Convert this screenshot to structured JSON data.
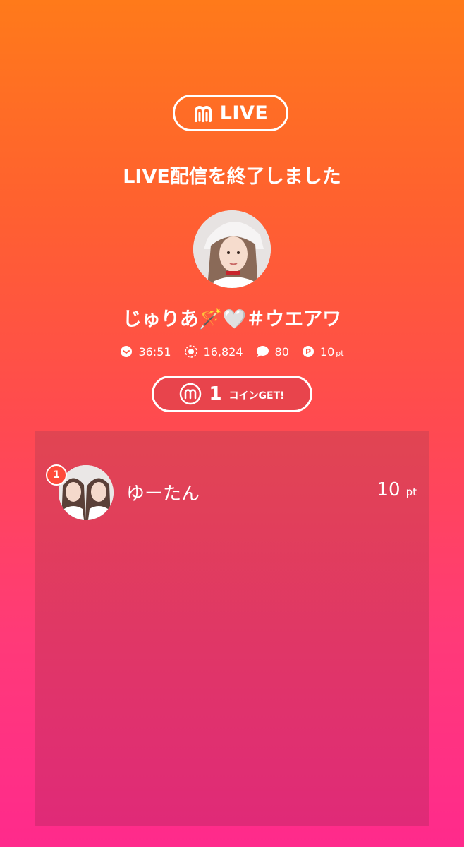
{
  "header": {
    "logo_text": "LIVE",
    "ended_title": "LIVE配信を終了しました"
  },
  "host": {
    "name": "じゅりあ🪄🤍＃ウエアワ"
  },
  "stats": {
    "duration": "36:51",
    "viewers": "16,824",
    "comments": "80",
    "points": "10",
    "points_unit": "pt"
  },
  "coin": {
    "count": "1",
    "label": "コインGET!"
  },
  "ranking": [
    {
      "rank": "1",
      "name": "ゆーたん",
      "points": "10",
      "unit": "pt"
    }
  ],
  "colors": {
    "gradient_top": "#ff7a1a",
    "gradient_bottom": "#ff2a8c",
    "panel": "#e03a60",
    "coin_pill": "#e8444c",
    "rank_badge": "#ff4a3a"
  }
}
